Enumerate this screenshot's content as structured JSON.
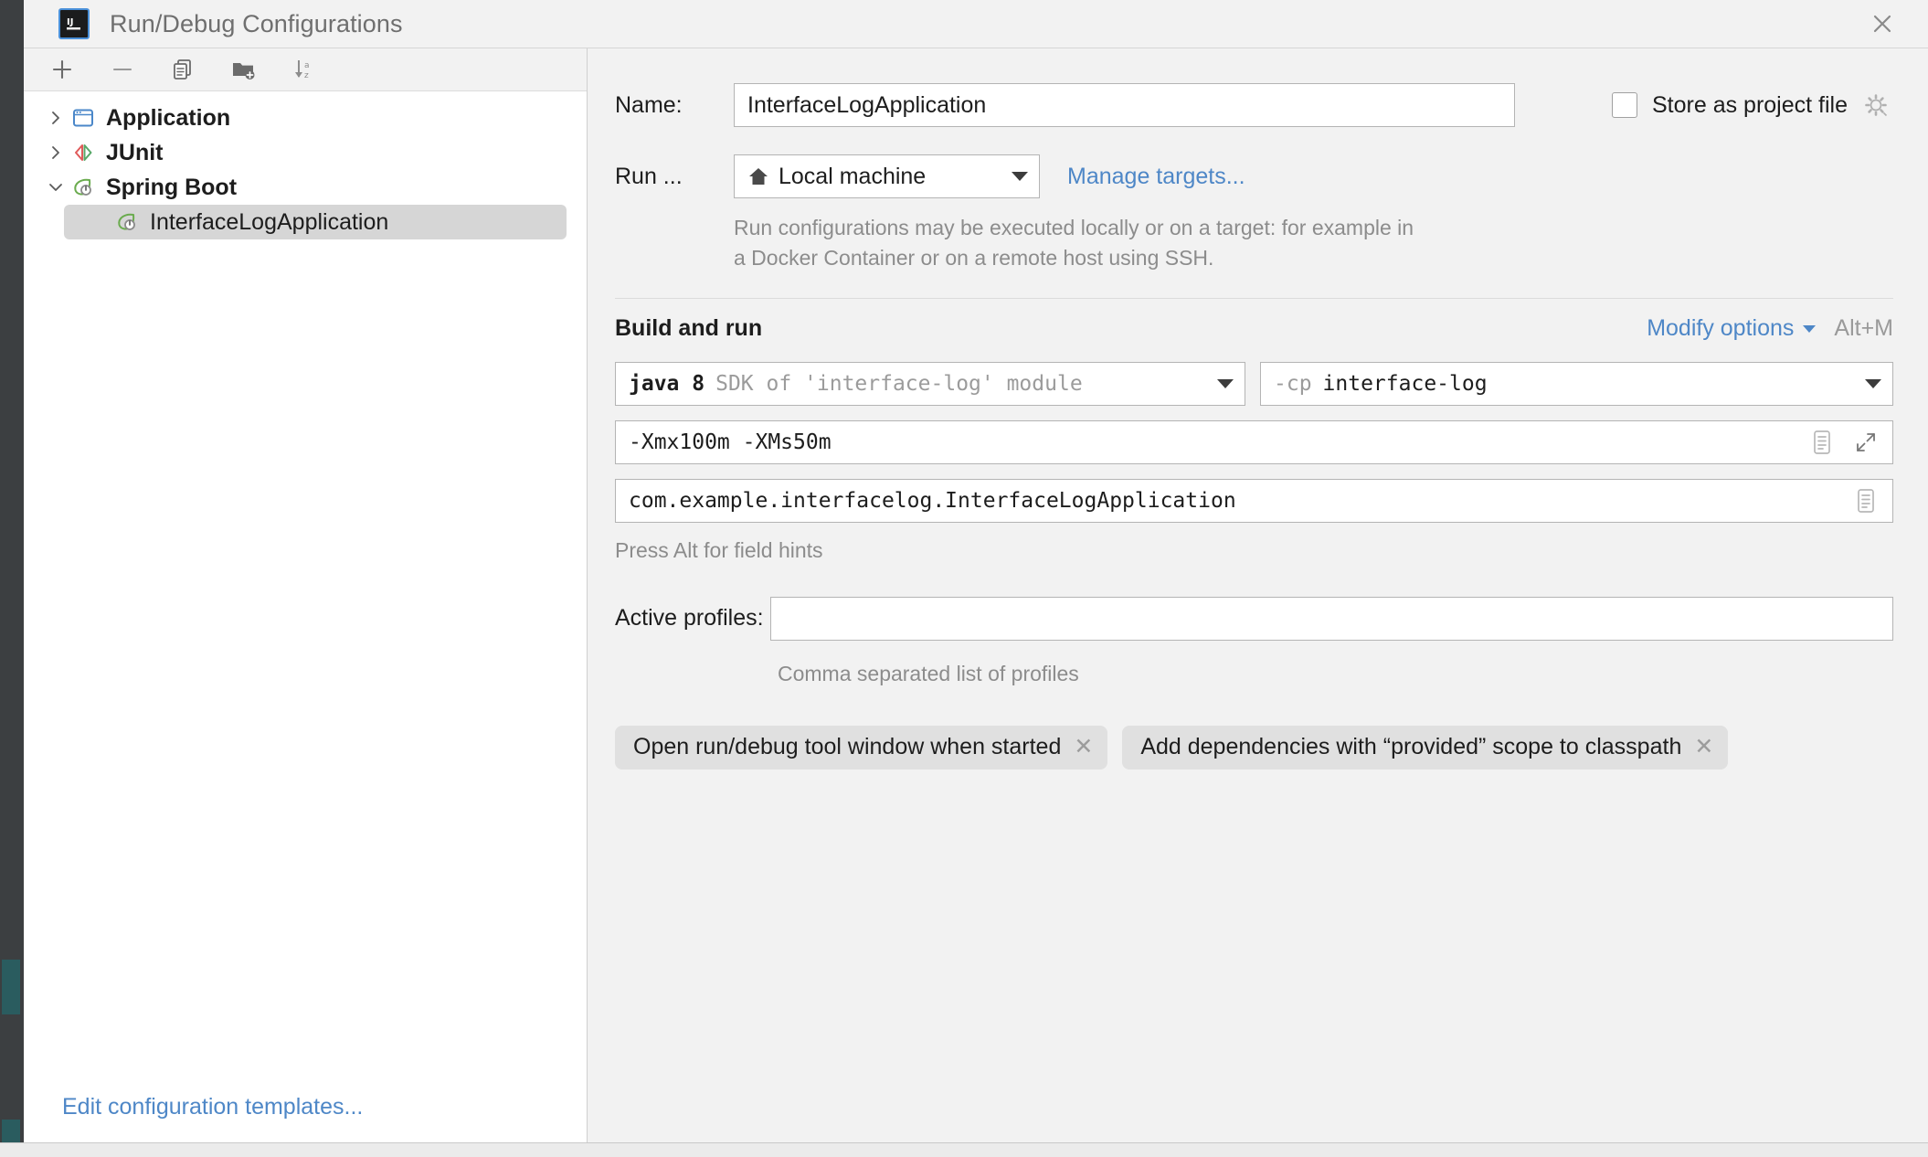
{
  "window": {
    "title": "Run/Debug Configurations",
    "logo_icon": "intellij-idea-logo",
    "close_icon": "close-icon"
  },
  "left_panel": {
    "toolbar": [
      {
        "name": "add-configuration-button",
        "icon": "plus-icon"
      },
      {
        "name": "remove-configuration-button",
        "icon": "minus-icon"
      },
      {
        "name": "copy-configuration-button",
        "icon": "copy-icon"
      },
      {
        "name": "new-folder-button",
        "icon": "new-folder-icon"
      },
      {
        "name": "sort-configurations-button",
        "icon": "sort-alphabetical-icon"
      }
    ],
    "tree": [
      {
        "label": "Application",
        "icon": "application-icon",
        "expanded": false,
        "level": 0,
        "selected": false
      },
      {
        "label": "JUnit",
        "icon": "junit-icon",
        "expanded": false,
        "level": 0,
        "selected": false
      },
      {
        "label": "Spring Boot",
        "icon": "spring-boot-icon",
        "expanded": true,
        "level": 0,
        "selected": false
      },
      {
        "label": "InterfaceLogApplication",
        "icon": "spring-boot-icon",
        "expanded": null,
        "level": 1,
        "selected": true
      }
    ],
    "footer_link": "Edit configuration templates..."
  },
  "form": {
    "name_label": "Name:",
    "name_value": "InterfaceLogApplication",
    "store_as_project_file_label": "Store as project file",
    "store_as_project_file_checked": false,
    "store_gear_icon": "gear-icon",
    "run_label": "Run ...",
    "run_target_value": "Local machine",
    "run_target_icon": "home-icon",
    "manage_targets_link": "Manage targets...",
    "run_description": "Run configurations may be executed locally or on a target: for example in a Docker Container or on a remote host using SSH.",
    "section_title": "Build and run",
    "modify_options_link": "Modify options",
    "modify_options_shortcut": "Alt+M",
    "jdk_prefix": "java 8",
    "jdk_suffix": "SDK of 'interface-log' module",
    "classpath_prefix": "-cp",
    "classpath_value": "interface-log",
    "vm_options_value": "-Xmx100m -XMs50m",
    "vm_options_icons": [
      "macro-list-icon",
      "expand-icon"
    ],
    "main_class_value": "com.example.interfacelog.InterfaceLogApplication",
    "main_class_icon": "macro-list-icon",
    "press_alt_hint": "Press Alt for field hints",
    "active_profiles_label": "Active profiles:",
    "active_profiles_value": "",
    "active_profiles_hint": "Comma separated list of profiles",
    "chips": [
      {
        "label": "Open run/debug tool window when started",
        "remove_icon": "close-small-icon"
      },
      {
        "label": "Add dependencies with “provided” scope to classpath",
        "remove_icon": "close-small-icon"
      }
    ]
  },
  "colors": {
    "link": "#4e87c7",
    "dialog_bg": "#f2f2f2",
    "panel_bg": "#ffffff",
    "selection": "#d6d6d6",
    "spring_green": "#6aab4e",
    "junit_red": "#e05a5a",
    "junit_green": "#59a869",
    "app_blue": "#4a87c9"
  }
}
